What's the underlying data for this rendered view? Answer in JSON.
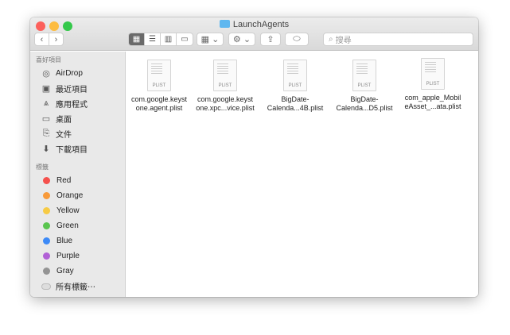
{
  "window": {
    "title": "LaunchAgents"
  },
  "toolbar": {
    "back": "‹",
    "forward": "›",
    "search_placeholder": "搜尋"
  },
  "sidebar": {
    "favorites_header": "喜好項目",
    "favorites": [
      {
        "label": "AirDrop",
        "icon": "airdrop-icon"
      },
      {
        "label": "最近項目",
        "icon": "recents-icon"
      },
      {
        "label": "應用程式",
        "icon": "applications-icon"
      },
      {
        "label": "桌面",
        "icon": "desktop-icon"
      },
      {
        "label": "文件",
        "icon": "documents-icon"
      },
      {
        "label": "下載項目",
        "icon": "downloads-icon"
      }
    ],
    "tags_header": "標籤",
    "tags": [
      {
        "label": "Red",
        "color": "#f5514d"
      },
      {
        "label": "Orange",
        "color": "#f89a3a"
      },
      {
        "label": "Yellow",
        "color": "#f7cb45"
      },
      {
        "label": "Green",
        "color": "#5ac54f"
      },
      {
        "label": "Blue",
        "color": "#3d8af7"
      },
      {
        "label": "Purple",
        "color": "#b161d6"
      },
      {
        "label": "Gray",
        "color": "#949494"
      }
    ],
    "all_tags": "所有標籤⋯"
  },
  "files": [
    {
      "line1": "com.google.keyst",
      "line2": "one.agent.plist",
      "kind": "PLIST"
    },
    {
      "line1": "com.google.keyst",
      "line2": "one.xpc...vice.plist",
      "kind": "PLIST"
    },
    {
      "line1": "BigDate-",
      "line2": "Calenda...4B.plist",
      "kind": "PLIST"
    },
    {
      "line1": "BigDate-",
      "line2": "Calenda...D5.plist",
      "kind": "PLIST"
    },
    {
      "line1": "com_apple_Mobil",
      "line2": "eAsset_...ata.plist",
      "kind": "PLIST"
    }
  ]
}
